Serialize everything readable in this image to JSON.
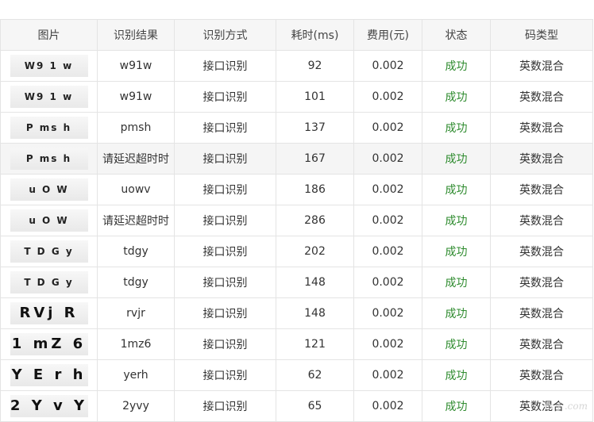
{
  "table": {
    "headers": [
      "图片",
      "识别结果",
      "识别方式",
      "耗时(ms)",
      "费用(元)",
      "状态",
      "码类型"
    ],
    "rows": [
      {
        "captcha": "W9 1 w",
        "captcha_style": "small",
        "result": "w91w",
        "method": "接口识别",
        "time_ms": "92",
        "cost": "0.002",
        "status": "成功",
        "code_type": "英数混合"
      },
      {
        "captcha": "W9 1 w",
        "captcha_style": "small",
        "result": "w91w",
        "method": "接口识别",
        "time_ms": "101",
        "cost": "0.002",
        "status": "成功",
        "code_type": "英数混合"
      },
      {
        "captcha": "P ms h",
        "captcha_style": "small",
        "result": "pmsh",
        "method": "接口识别",
        "time_ms": "137",
        "cost": "0.002",
        "status": "成功",
        "code_type": "英数混合"
      },
      {
        "captcha": "P ms h",
        "captcha_style": "small",
        "result": "请延迟超时时",
        "method": "接口识别",
        "time_ms": "167",
        "cost": "0.002",
        "status": "成功",
        "code_type": "英数混合"
      },
      {
        "captcha": "u O W",
        "captcha_style": "small",
        "result": "uowv",
        "method": "接口识别",
        "time_ms": "186",
        "cost": "0.002",
        "status": "成功",
        "code_type": "英数混合"
      },
      {
        "captcha": "u O W",
        "captcha_style": "small",
        "result": "请延迟超时时",
        "method": "接口识别",
        "time_ms": "286",
        "cost": "0.002",
        "status": "成功",
        "code_type": "英数混合"
      },
      {
        "captcha": "T D G y",
        "captcha_style": "small",
        "result": "tdgy",
        "method": "接口识别",
        "time_ms": "202",
        "cost": "0.002",
        "status": "成功",
        "code_type": "英数混合"
      },
      {
        "captcha": "T D G y",
        "captcha_style": "small",
        "result": "tdgy",
        "method": "接口识别",
        "time_ms": "148",
        "cost": "0.002",
        "status": "成功",
        "code_type": "英数混合"
      },
      {
        "captcha": "RVj R",
        "captcha_style": "large",
        "result": "rvjr",
        "method": "接口识别",
        "time_ms": "148",
        "cost": "0.002",
        "status": "成功",
        "code_type": "英数混合"
      },
      {
        "captcha": "1 mZ 6",
        "captcha_style": "large",
        "result": "1mz6",
        "method": "接口识别",
        "time_ms": "121",
        "cost": "0.002",
        "status": "成功",
        "code_type": "英数混合"
      },
      {
        "captcha": "Y E r h",
        "captcha_style": "large",
        "result": "yerh",
        "method": "接口识别",
        "time_ms": "62",
        "cost": "0.002",
        "status": "成功",
        "code_type": "英数混合"
      },
      {
        "captcha": "2 Y v Y",
        "captcha_style": "large",
        "result": "2yvy",
        "method": "接口识别",
        "time_ms": "65",
        "cost": "0.002",
        "status": "成功",
        "code_type": "英数混合"
      }
    ],
    "hover_row_index": 3
  },
  "colors": {
    "status_success": "#2e8b2e",
    "header_bg": "#f6f6f6",
    "border": "#e4e4e4",
    "hover_bg": "#f5f5f5"
  }
}
